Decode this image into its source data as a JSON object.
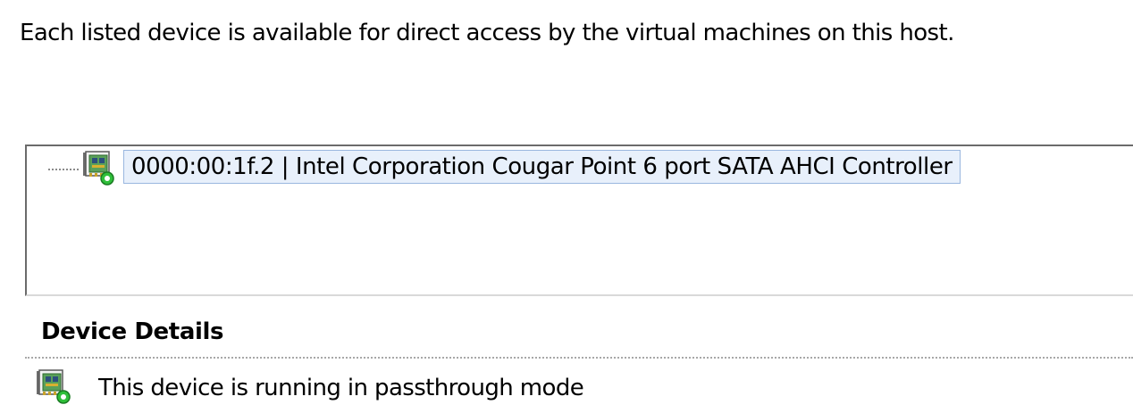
{
  "description": "Each listed device is available for direct access by the virtual machines on this host.",
  "devices": [
    {
      "label": "0000:00:1f.2 | Intel Corporation Cougar Point 6 port SATA AHCI Controller",
      "icon": "pci-device-passthrough-icon"
    }
  ],
  "details": {
    "heading": "Device Details",
    "status_text": "This device is running in passthrough mode",
    "status_icon": "pci-device-passthrough-icon"
  },
  "colors": {
    "selection_background": "#e8f0fb",
    "selection_border": "#9ab7df",
    "card_green": "#5aa05a",
    "status_green": "#2fbf3a"
  }
}
